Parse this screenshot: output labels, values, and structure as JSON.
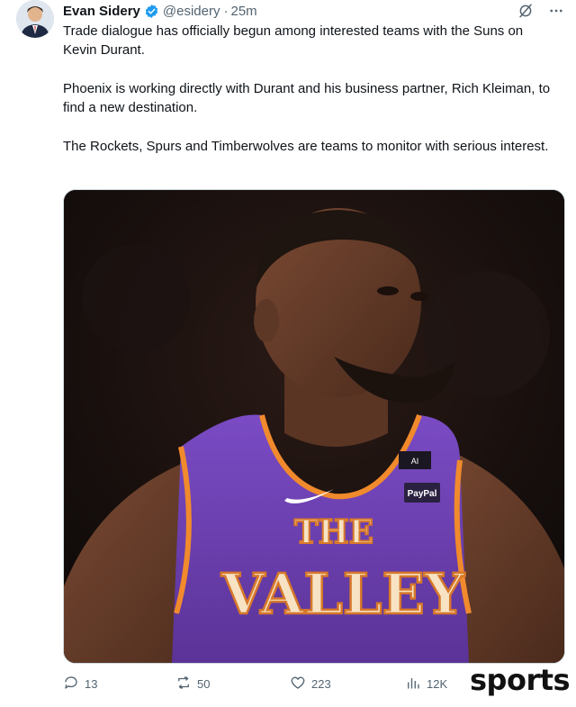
{
  "author": {
    "name": "Evan Sidery",
    "handle": "@esidery",
    "separator": "·",
    "time": "25m"
  },
  "tweet": {
    "paragraphs": [
      "Trade dialogue has officially begun among interested teams with the Suns on Kevin Durant.",
      "Phoenix is working directly with Durant and his business partner, Rich Kleiman, to find a new destination.",
      "The Rockets, Spurs and Timberwolves are teams to monitor with serious interest."
    ]
  },
  "media": {
    "jersey_top": "THE",
    "jersey_main": "VALLEY",
    "sponsor": "PayPal",
    "tag": "AI"
  },
  "actions": {
    "replies": "13",
    "reposts": "50",
    "likes": "223",
    "views": "12K"
  },
  "watermark": "sports",
  "icons": {
    "verified": "verified-badge-icon",
    "grok": "grok-icon",
    "more": "more-icon",
    "reply": "reply-icon",
    "repost": "repost-icon",
    "like": "heart-icon",
    "views": "views-icon"
  },
  "colors": {
    "verified_blue": "#1d9bf0",
    "muted": "#536471",
    "jersey_purple": "#6a3fb0",
    "jersey_orange": "#f08a2c"
  }
}
